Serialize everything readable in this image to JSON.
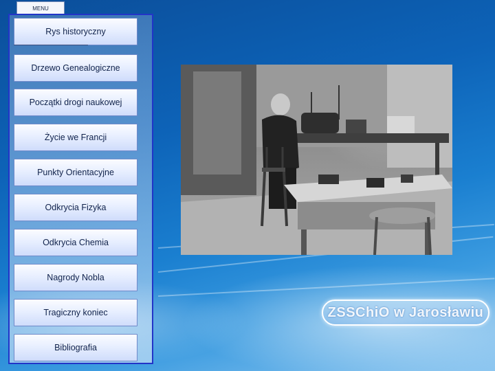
{
  "menu": {
    "tab_label": "MENU",
    "items": [
      {
        "label": "Rys historyczny"
      },
      {
        "label": "Drzewo Genealogiczne"
      },
      {
        "label": "Początki drogi naukowej"
      },
      {
        "label": "Życie we Francji"
      },
      {
        "label": "Punkty Orientacyjne"
      },
      {
        "label": "Odkrycia Fizyka"
      },
      {
        "label": "Odkrycia Chemia"
      },
      {
        "label": "Nagrody Nobla"
      },
      {
        "label": "Tragiczny koniec"
      },
      {
        "label": "Bibliografia"
      }
    ]
  },
  "logo": {
    "text": "ZSSChiO w Jarosławiu"
  },
  "colors": {
    "menu_border": "#2234c8",
    "button_border": "#6f89c9",
    "background": "#0d63b8"
  }
}
